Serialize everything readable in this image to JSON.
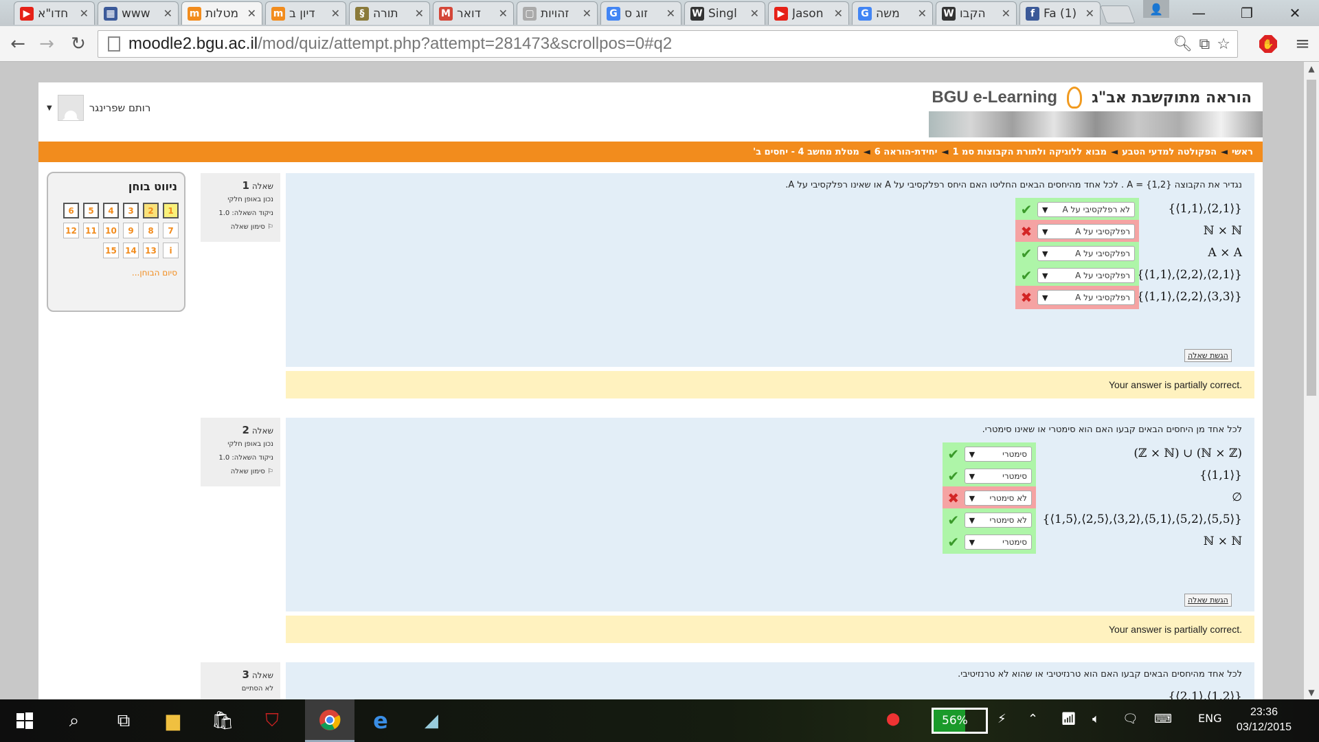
{
  "browser": {
    "tabs": [
      {
        "title": "חדו\"א",
        "icon": "youtube-icon",
        "color": "#e62117",
        "glyph": "▶"
      },
      {
        "title": "www",
        "icon": "grid-icon",
        "color": "#3c5a9a",
        "glyph": "▦"
      },
      {
        "title": "מטלות",
        "icon": "moodle-icon",
        "color": "#f28c1d",
        "glyph": "m",
        "active": true
      },
      {
        "title": "דיון ב",
        "icon": "moodle-icon",
        "color": "#f28c1d",
        "glyph": "m"
      },
      {
        "title": "תורה",
        "icon": "book-icon",
        "color": "#8a7a3a",
        "glyph": "§"
      },
      {
        "title": "דואר",
        "icon": "gmail-icon",
        "color": "#d44638",
        "glyph": "M"
      },
      {
        "title": "זהויות",
        "icon": "page-icon",
        "color": "#aaaaaa",
        "glyph": "▢"
      },
      {
        "title": "זוג ס",
        "icon": "google-icon",
        "color": "#4285f4",
        "glyph": "G"
      },
      {
        "title": "Singl",
        "icon": "wikipedia-icon",
        "color": "#333333",
        "glyph": "W"
      },
      {
        "title": "Jason",
        "icon": "youtube-icon",
        "color": "#e62117",
        "glyph": "▶"
      },
      {
        "title": "משה",
        "icon": "google-icon",
        "color": "#4285f4",
        "glyph": "G"
      },
      {
        "title": "הקבו",
        "icon": "wikipedia-icon",
        "color": "#333333",
        "glyph": "W"
      },
      {
        "title": "(1) Fa",
        "icon": "facebook-icon",
        "color": "#3b5998",
        "glyph": "f"
      }
    ],
    "url_host": "moodle2.bgu.ac.il",
    "url_path": "/mod/quiz/attempt.php?attempt=281473&scrollpos=0#q2"
  },
  "header": {
    "user_name": "רותם שפרינגר",
    "logo_hebrew": "הוראה מתוקשבת אב\"ג",
    "logo_english": "BGU e-Learning"
  },
  "breadcrumbs": [
    "ראשי",
    "הפקולטה למדעי הטבע",
    "מבוא ללוגיקה ולתורת הקבוצות סמ 1",
    "יחידת-הוראה 6",
    "מטלת מחשב 4 - יחסים ב'"
  ],
  "quiz_nav": {
    "title": "ניווט בוחן",
    "buttons": [
      "1",
      "2",
      "3",
      "4",
      "5",
      "6",
      "7",
      "8",
      "9",
      "10",
      "11",
      "12",
      "i",
      "13",
      "14",
      "15"
    ],
    "finish": "סיום הבוחן..."
  },
  "questions": [
    {
      "number_label": "שאלה",
      "number": "1",
      "status": "נכון באופן חלקי",
      "grade": "ניקוד השאלה: 1.0",
      "flag": "סימון שאלה",
      "text": "נגדיר את הקבוצה A = {1,2} . לכל אחד מהיחסים הבאים החליטו האם היחס רפלקסיבי על A או שאינו רפלקסיבי על A.",
      "rows": [
        {
          "expr": "{⟨1,1⟩,⟨2,1⟩}",
          "answer": "לא רפלקסיבי על A",
          "correct": true
        },
        {
          "expr": "ℕ × ℕ",
          "answer": "רפלקסיבי על A",
          "correct": false
        },
        {
          "expr": "A × A",
          "answer": "רפלקסיבי על A",
          "correct": true
        },
        {
          "expr": "{⟨1,1⟩,⟨2,2⟩,⟨2,1⟩}",
          "answer": "רפלקסיבי על A",
          "correct": true
        },
        {
          "expr": "{⟨1,1⟩,⟨2,2⟩,⟨3,3⟩}",
          "answer": "רפלקסיבי על A",
          "correct": false
        }
      ],
      "submit": "הגשת שאלה",
      "feedback": "Your answer is partially correct."
    },
    {
      "number_label": "שאלה",
      "number": "2",
      "status": "נכון באופן חלקי",
      "grade": "ניקוד השאלה: 1.0",
      "flag": "סימון שאלה",
      "text": "לכל אחד מן היחסים הבאים קבעו האם הוא סימטרי או שאינו סימטרי.",
      "rows": [
        {
          "expr": "(ℤ × ℕ) ∪ (ℕ × ℤ)",
          "answer": "סימטרי",
          "correct": true
        },
        {
          "expr": "{⟨1,1⟩}",
          "answer": "סימטרי",
          "correct": true
        },
        {
          "expr": "∅",
          "answer": "לא סימטרי",
          "correct": false
        },
        {
          "expr": "{⟨1,5⟩,⟨2,5⟩,⟨3,2⟩,⟨5,1⟩,⟨5,2⟩,⟨5,5⟩}",
          "answer": "לא סימטרי",
          "correct": true
        },
        {
          "expr": "ℕ × ℕ",
          "answer": "סימטרי",
          "correct": true
        }
      ],
      "submit": "הגשת שאלה",
      "feedback": "Your answer is partially correct."
    },
    {
      "number_label": "שאלה",
      "number": "3",
      "status": "לא הסתיים",
      "text": "לכל אחד מהיחסים הבאים קבעו האם הוא טרנזיטיבי או שהוא לא טרנזיטיבי.",
      "first_expr": "{⟨2,1⟩,⟨1,2⟩}"
    }
  ],
  "taskbar": {
    "battery": "56%",
    "language": "ENG",
    "time": "23:36",
    "date": "03/12/2015"
  }
}
